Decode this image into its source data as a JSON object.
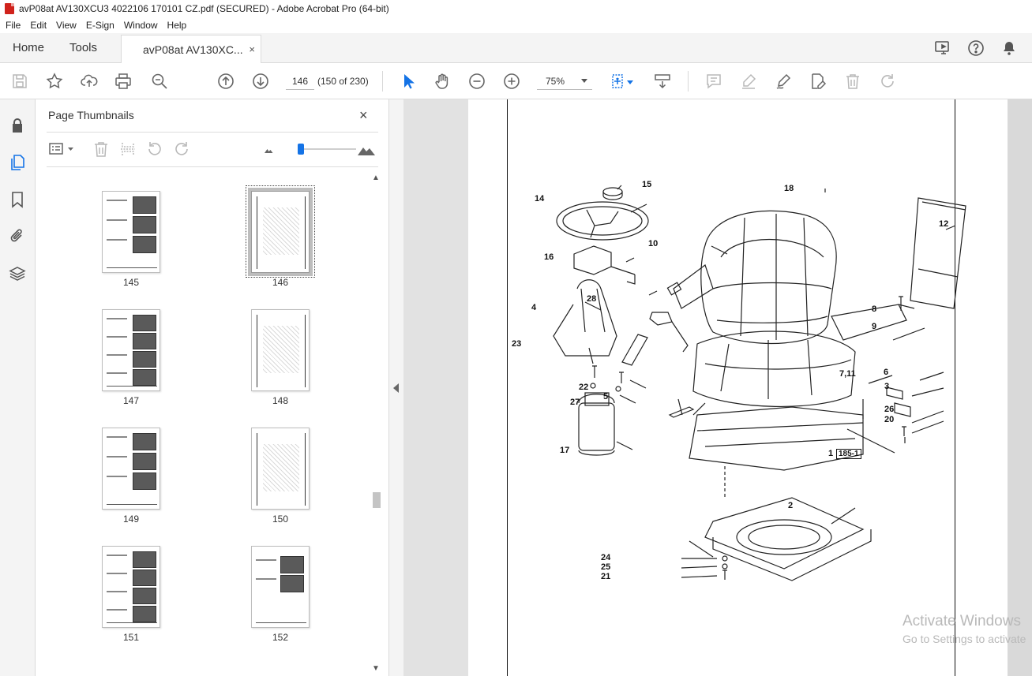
{
  "window": {
    "title": "avP08at AV130XCU3 4022106 170101 CZ.pdf (SECURED) - Adobe Acrobat Pro (64-bit)"
  },
  "menu": [
    "File",
    "Edit",
    "View",
    "E-Sign",
    "Window",
    "Help"
  ],
  "tabs": {
    "home": "Home",
    "tools": "Tools",
    "document": "avP08at AV130XC...",
    "close_glyph": "×"
  },
  "toolbar": {
    "page_number": "146",
    "page_count": "(150 of 230)",
    "zoom": "75%"
  },
  "panel": {
    "title": "Page Thumbnails",
    "close_glyph": "×",
    "thumbnail_size_fraction": 0.0,
    "thumbnails": [
      {
        "label": "145",
        "style": "photos3"
      },
      {
        "label": "146",
        "style": "drawing",
        "selected": true
      },
      {
        "label": "147",
        "style": "photos4"
      },
      {
        "label": "148",
        "style": "drawing"
      },
      {
        "label": "149",
        "style": "photos3"
      },
      {
        "label": "150",
        "style": "drawing"
      },
      {
        "label": "151",
        "style": "photos4"
      },
      {
        "label": "152",
        "style": "photos2"
      }
    ]
  },
  "drawing": {
    "callouts": [
      "15",
      "18",
      "14",
      "12",
      "16",
      "10",
      "28",
      "4",
      "8",
      "9",
      "23",
      "7,11",
      "6",
      "22",
      "3",
      "5",
      "27",
      "26",
      "20",
      "17",
      "1",
      "185-1",
      "2",
      "24",
      "25",
      "21"
    ]
  },
  "watermark": {
    "line1": "Activate Windows",
    "line2": "Go to Settings to activate"
  },
  "colors": {
    "accent": "#1473e6",
    "pdf_red": "#d0221b"
  }
}
